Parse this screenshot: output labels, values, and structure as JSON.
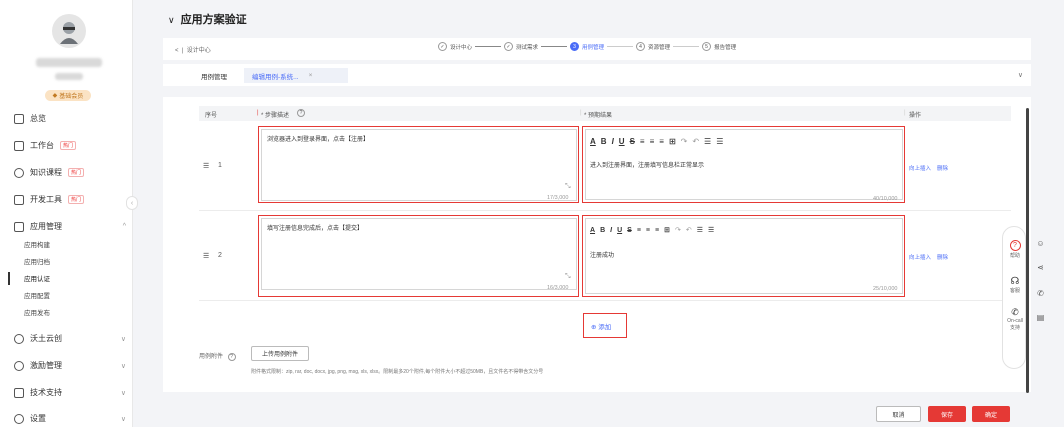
{
  "sidebar": {
    "badge": "基础会员",
    "nav": [
      {
        "label": "总览",
        "tag": "",
        "chev": ""
      },
      {
        "label": "工作台",
        "tag": "热门",
        "chev": ""
      },
      {
        "label": "知识课程",
        "tag": "热门",
        "chev": ""
      },
      {
        "label": "开发工具",
        "tag": "热门",
        "chev": ""
      },
      {
        "label": "应用管理",
        "tag": "",
        "chev": "^"
      },
      {
        "label": "沃土云创",
        "tag": "",
        "chev": "∨"
      },
      {
        "label": "激励管理",
        "tag": "",
        "chev": "∨"
      },
      {
        "label": "技术支持",
        "tag": "",
        "chev": "∨"
      },
      {
        "label": "设置",
        "tag": "",
        "chev": "∨"
      }
    ],
    "subitems": [
      "应用构建",
      "应用归档",
      "应用认证",
      "应用配置",
      "应用发布"
    ]
  },
  "page": {
    "title": "应用方案验证",
    "title_chev": "∨"
  },
  "topbar": {
    "back": "<  |  设计中心",
    "steps": [
      {
        "label": "设计中心",
        "mark": "✓"
      },
      {
        "label": "测试需求",
        "mark": "✓"
      },
      {
        "label": "用例管理",
        "mark": "3"
      },
      {
        "label": "资源管理",
        "mark": "4"
      },
      {
        "label": "报告管理",
        "mark": "5"
      }
    ]
  },
  "tabs": {
    "first": "用例管理",
    "second": "编辑用例-系统...",
    "close": "×",
    "chev": "∨"
  },
  "table": {
    "headers": {
      "seq": "序号",
      "steps": "* 步骤描述",
      "expected": "* 预期结果",
      "op": "操作"
    },
    "help": "?",
    "rows": [
      {
        "num": "1",
        "step": "浏览器进入到登录界面，点击【注册】",
        "step_count": "17/3,000",
        "expected": "进入到注册界面，注册填写信息栏正常显示",
        "expected_count": "40/10,000"
      },
      {
        "num": "2",
        "step": "填写注册信息完成后，点击【提交】",
        "step_count": "16/3,000",
        "expected": "注册成功",
        "expected_count": "25/10,000"
      }
    ],
    "ops": {
      "insert": "向上插入",
      "delete": "删除"
    }
  },
  "toolbar": {
    "a": "A",
    "b": "B",
    "i": "I",
    "u": "U",
    "s": "S",
    "grid": "⊞",
    "undo": "↶",
    "redo": "↷"
  },
  "add": {
    "icon": "⊕",
    "label": "添加"
  },
  "attach": {
    "label": "用例附件",
    "help": "?",
    "button": "上传用例附件",
    "hint": "附件格式限制：zip, rar, doc, docx, jpg, png, msg, xls, xlsx。限制最多20个附件,每个附件大小不超过50MB，且文件名不得带含文分号"
  },
  "footer": {
    "cancel": "取消",
    "save": "保存",
    "confirm": "确定"
  },
  "float": {
    "help": "帮助",
    "service": "客服",
    "oncall": "On-call",
    "support": "支持"
  },
  "colors": {
    "primary": "#4a6cf7",
    "danger": "#e53935"
  }
}
